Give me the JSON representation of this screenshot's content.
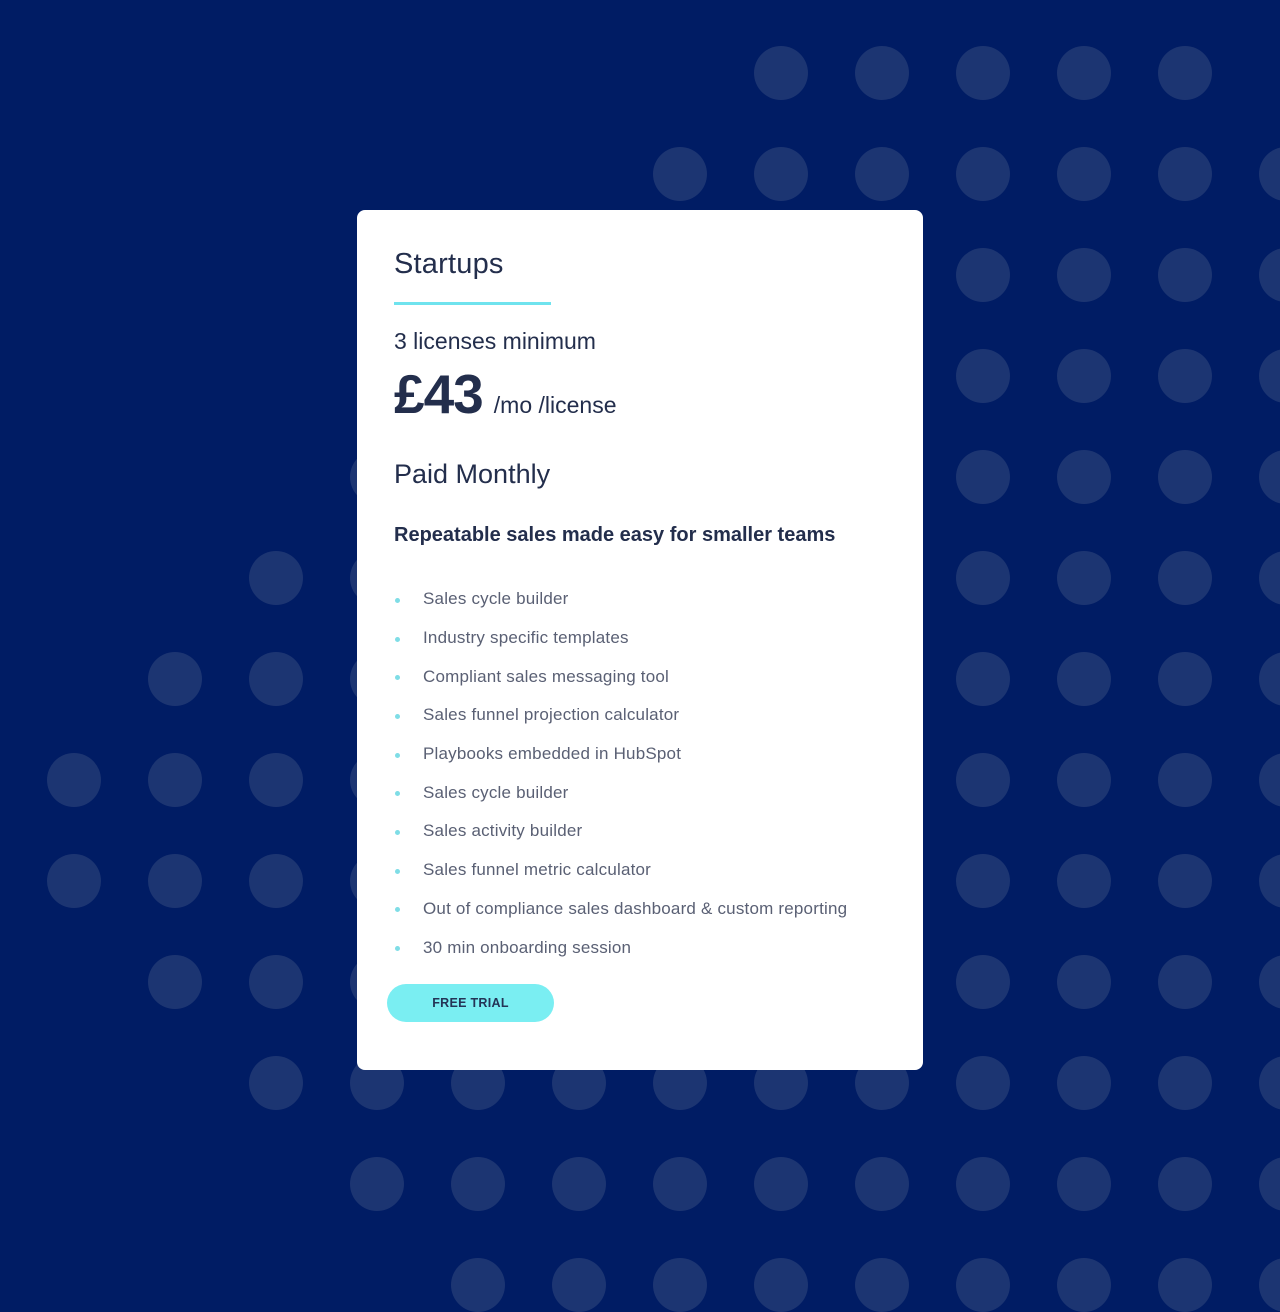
{
  "theme": {
    "background": "#001c64",
    "dot_color": "#1c3572",
    "card_background": "#ffffff",
    "accent": "#7aeef2",
    "text_primary": "#232e4c",
    "text_secondary": "#5a6074"
  },
  "plan": {
    "name": "Startups",
    "minimum": "3 licenses minimum",
    "price": "£43",
    "price_unit": "/mo /license",
    "billing": "Paid Monthly",
    "tagline": "Repeatable sales made easy for smaller teams",
    "features": [
      "Sales cycle builder",
      "Industry specific templates",
      "Compliant sales messaging tool",
      "Sales funnel projection calculator",
      "Playbooks embedded in HubSpot",
      "Sales cycle builder",
      "Sales activity builder",
      "Sales funnel metric calculator",
      "Out of compliance sales dashboard & custom reporting",
      "30 min onboarding session"
    ],
    "cta_label": "FREE TRIAL"
  }
}
